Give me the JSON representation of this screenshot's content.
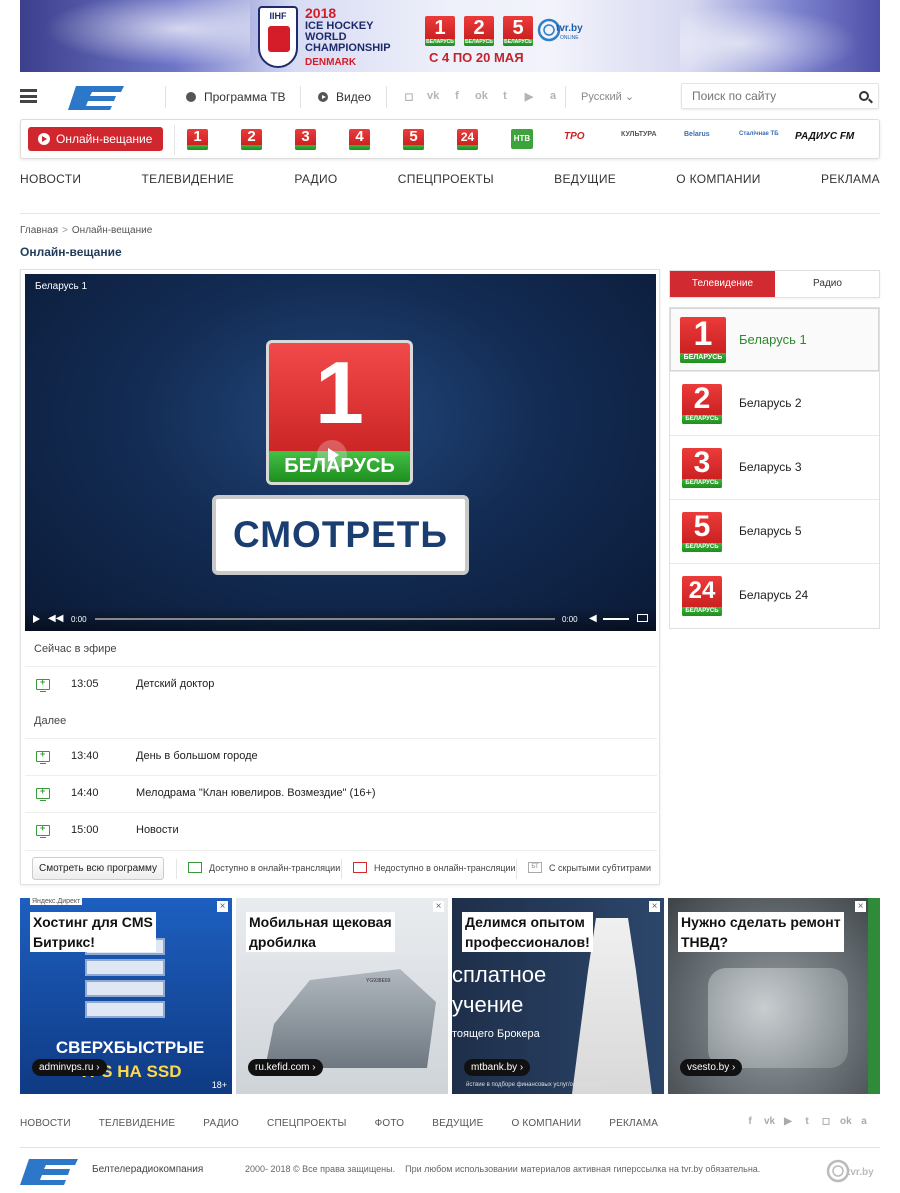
{
  "banner": {
    "org": "IIHF",
    "year": "2018",
    "title_lines": [
      "ICE HOCKEY",
      "WORLD",
      "CHAMPIONSHIP"
    ],
    "country": "DENMARK",
    "dates": "С 4 ПО 20 МАЯ",
    "channel_numbers": [
      "1",
      "2",
      "5"
    ],
    "channel_caption": "БЕЛАРУСЬ",
    "tvr_label": "tvr.by",
    "tvr_sub": "ONLINE"
  },
  "header": {
    "logo": "БТ",
    "program_label": "Программа ТВ",
    "video_label": "Видео",
    "lang_label": "Русский",
    "search_placeholder": "Поиск по сайту"
  },
  "channel_bar": {
    "live_label": "Онлайн-вещание",
    "channels": [
      "1",
      "2",
      "3",
      "4",
      "5",
      "24"
    ],
    "channel_caption": "БЕЛАРУСЬ",
    "extra": [
      "НТВ",
      "ТРО",
      "КУЛЬТУРА",
      "Belarus",
      "Сталічнае ТБ",
      "РАДИУС FM"
    ]
  },
  "nav": [
    "НОВОСТИ",
    "ТЕЛЕВИДЕНИЕ",
    "РАДИО",
    "СПЕЦПРОЕКТЫ",
    "ВЕДУЩИЕ",
    "О КОМПАНИИ",
    "РЕКЛАМА"
  ],
  "breadcrumb": {
    "home": "Главная",
    "sep": ">",
    "current": "Онлайн-вещание"
  },
  "page_title": "Онлайн-вещание",
  "player": {
    "title": "Беларусь 1",
    "logo_number": "1",
    "logo_caption": "БЕЛАРУСЬ",
    "watch_label": "СМОТРЕТЬ",
    "time_current": "0:00",
    "time_total": "0:00"
  },
  "schedule": {
    "now_label": "Сейчас в эфире",
    "now": [
      {
        "time": "13:05",
        "name": "Детский доктор"
      }
    ],
    "next_label": "Далее",
    "next": [
      {
        "time": "13:40",
        "name": "День в большом городе"
      },
      {
        "time": "14:40",
        "name": "Мелодрама \"Клан ювелиров. Возмездие\" (16+)"
      },
      {
        "time": "15:00",
        "name": "Новости"
      }
    ],
    "all_button": "Смотреть всю программу",
    "legend": {
      "available": "Доступно в онлайн-трансляции",
      "unavailable": "Недоступно в онлайн-трансляции",
      "subtitles": "С скрытыми субтитрами",
      "subtitles_icon": "БТ"
    }
  },
  "sidebar": {
    "tabs": [
      "Телевидение",
      "Радио"
    ],
    "channels": [
      {
        "number": "1",
        "name": "Беларусь 1"
      },
      {
        "number": "2",
        "name": "Беларусь 2"
      },
      {
        "number": "3",
        "name": "Беларусь 3"
      },
      {
        "number": "5",
        "name": "Беларусь 5"
      },
      {
        "number": "24",
        "name": "Беларусь 24"
      }
    ],
    "channel_caption": "БЕЛАРУСЬ"
  },
  "ads": {
    "network_label": "Яндекс.Директ",
    "close": "×",
    "items": [
      {
        "title_lines": [
          "Хостинг для CMS",
          "Битрикс!"
        ],
        "domain": "adminvps.ru ›",
        "image_lines": [
          "СВЕРХБЫСТРЫЕ",
          "VPS НА SSD"
        ],
        "badge": "18+"
      },
      {
        "title_lines": [
          "Мобильная щековая",
          "дробилка"
        ],
        "domain": "ru.kefid.com ›",
        "image_lines": [
          "YG938E69"
        ]
      },
      {
        "title_lines": [
          "Делимся опытом",
          "профессионалов!"
        ],
        "domain": "mtbank.by ›",
        "image_lines": [
          "сплатное",
          "учение",
          "тоящего Брокера"
        ],
        "caption": "йствие в подборе финансовых услуг/организаций"
      },
      {
        "title_lines": [
          "Нужно сделать ремонт",
          "ТНВД?"
        ],
        "domain": "vsesto.by ›"
      }
    ]
  },
  "footer": {
    "nav": [
      "НОВОСТИ",
      "ТЕЛЕВИДЕНИЕ",
      "РАДИО",
      "СПЕЦПРОЕКТЫ",
      "ФОТО",
      "ВЕДУЩИЕ",
      "О КОМПАНИИ",
      "РЕКЛАМА"
    ],
    "company": "Белтелерадиокомпания",
    "copyright": "2000- 2018 © Все права защищены.",
    "notice": "При любом использовании материалов активная гиперссылка на tvr.by обязательна.",
    "logo": "БТ",
    "tvr_label": "tvr.by"
  },
  "colors": {
    "accent_red": "#d12a30",
    "green": "#2c8a2c",
    "navy": "#1f3b5a"
  }
}
